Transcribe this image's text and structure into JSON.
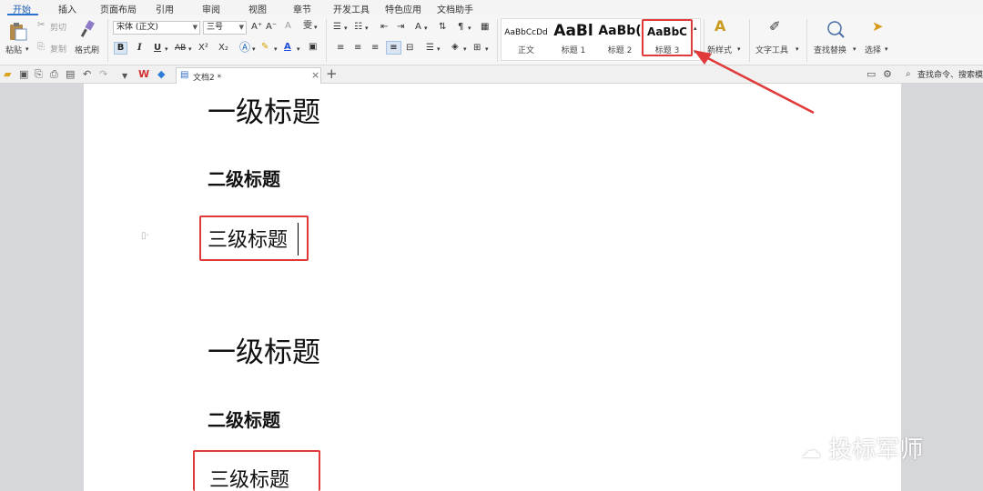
{
  "menu": {
    "tabs": [
      "开始",
      "插入",
      "页面布局",
      "引用",
      "审阅",
      "视图",
      "章节",
      "开发工具",
      "特色应用",
      "文档助手"
    ],
    "active_tab": "开始"
  },
  "ribbon": {
    "clipboard": {
      "paste_label": "粘贴",
      "cut_label": "剪切",
      "copy_label": "复制",
      "format_painter_label": "格式刷"
    },
    "font": {
      "font_name": "宋体 (正文)",
      "font_size": "三号",
      "bold": "B",
      "italic": "I",
      "underline": "U",
      "strikethrough": "AB",
      "superscript": "X²",
      "subscript": "X₂",
      "grow": "A⁺",
      "shrink": "A⁻",
      "clear": "A",
      "pinyin": "雯"
    },
    "styles": {
      "items": [
        {
          "sample": "AaBbCcDd",
          "name": "正文"
        },
        {
          "sample": "AaBl",
          "name": "标题 1"
        },
        {
          "sample": "AaBb(",
          "name": "标题 2"
        },
        {
          "sample": "AaBbC",
          "name": "标题 3"
        }
      ],
      "new_style_label": "新样式",
      "text_tools_label": "文字工具",
      "find_replace_label": "查找替换",
      "select_label": "选择"
    }
  },
  "tabbar": {
    "doc_tab_label": "文档2 *",
    "search_placeholder": "查找命令、搜索模板"
  },
  "document": {
    "headings": [
      {
        "level": 1,
        "text": "一级标题"
      },
      {
        "level": 2,
        "text": "二级标题"
      },
      {
        "level": 3,
        "text": "三级标题"
      },
      {
        "level": 1,
        "text": "一级标题"
      },
      {
        "level": 2,
        "text": "二级标题"
      },
      {
        "level": 3,
        "text": "三级标题"
      }
    ]
  },
  "watermark": "投标军师",
  "colors": {
    "accent": "#2b71cf",
    "annotation_red": "#e03a3a"
  }
}
